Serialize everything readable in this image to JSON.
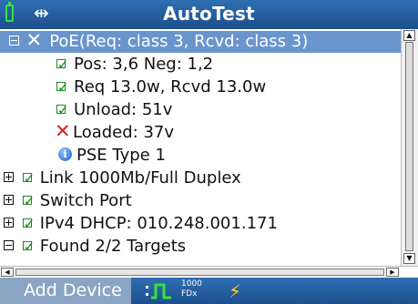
{
  "window": {
    "title": "AutoTest"
  },
  "status_icons": {
    "battery_icon": "battery-icon",
    "usb_icon": "usb-icon",
    "usb_glyph": "⇹"
  },
  "tree": {
    "poe": {
      "label": "PoE(Req: class 3, Rcvd: class 3)",
      "expanded": true,
      "status": "fail",
      "children": [
        {
          "status": "pass",
          "label": "Pos: 3,6 Neg: 1,2"
        },
        {
          "status": "pass",
          "label": "Req 13.0w, Rcvd 13.0w"
        },
        {
          "status": "pass",
          "label": "Unload: 51v"
        },
        {
          "status": "fail",
          "label": "Loaded: 37v"
        },
        {
          "status": "info",
          "label": "PSE Type 1"
        }
      ]
    },
    "items": [
      {
        "expander": "plus",
        "status": "pass",
        "label": "Link 1000Mb/Full Duplex"
      },
      {
        "expander": "plus",
        "status": "pass",
        "label": "Switch Port"
      },
      {
        "expander": "plus",
        "status": "pass",
        "label": "IPv4 DHCP: 010.248.001.171"
      },
      {
        "expander": "minus",
        "status": "pass",
        "label": "Found 2/2 Targets"
      }
    ]
  },
  "bottom": {
    "add_device_label": "Add Device",
    "speed_top": "1000",
    "speed_bottom": "FDx",
    "link_icon": "link-pulse-icon",
    "power_icon": "lightning-icon"
  },
  "colors": {
    "titlebar": "#2f6fb3",
    "selection": "#6a95cc",
    "pass": "#1a8a1a",
    "fail": "#e02020",
    "power": "#ffd21a"
  }
}
